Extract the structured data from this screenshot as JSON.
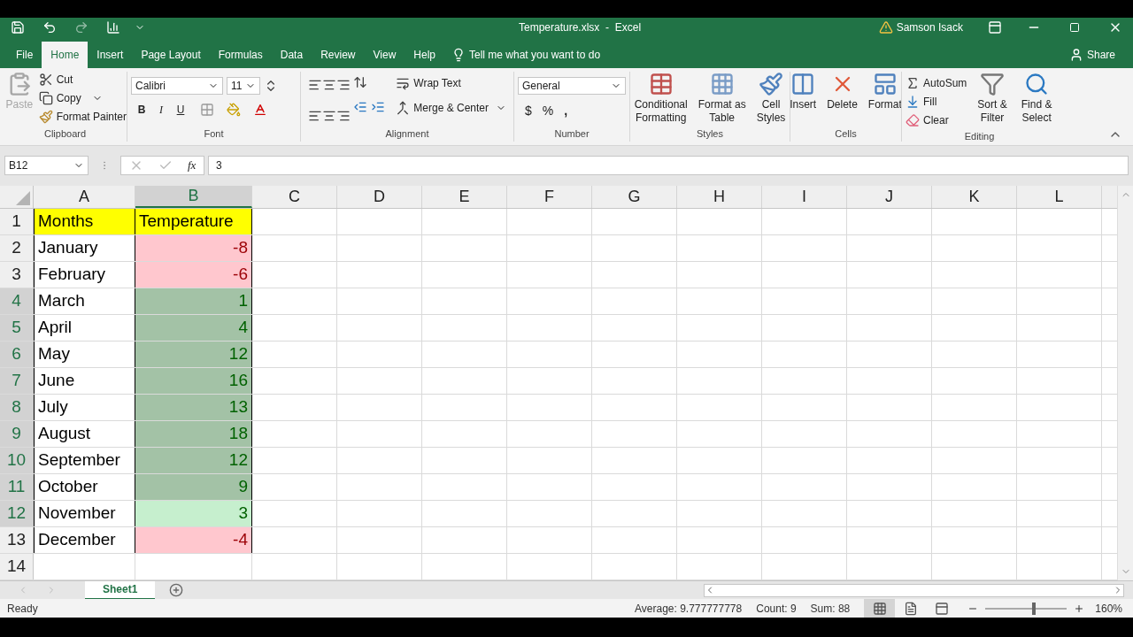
{
  "window": {
    "title": "Temperature.xlsx  -  Excel",
    "user": "Samson Isack"
  },
  "tabs": [
    {
      "label": "File",
      "selected": false
    },
    {
      "label": "Home",
      "selected": true
    },
    {
      "label": "Insert",
      "selected": false
    },
    {
      "label": "Page Layout",
      "selected": false
    },
    {
      "label": "Formulas",
      "selected": false
    },
    {
      "label": "Data",
      "selected": false
    },
    {
      "label": "Review",
      "selected": false
    },
    {
      "label": "View",
      "selected": false
    },
    {
      "label": "Help",
      "selected": false
    }
  ],
  "tell_me": {
    "placeholder": "Tell me what you want to do"
  },
  "share": "Share",
  "ribbon": {
    "clipboard": {
      "label": "Clipboard",
      "paste": {
        "label": "Paste",
        "disabled": true
      },
      "cut": "Cut",
      "copy": "Copy",
      "format_painter": "Format Painter"
    },
    "font": {
      "label": "Font",
      "font_name": "Calibri",
      "font_size": "11",
      "bold": "B",
      "italic": "I",
      "underline": "U"
    },
    "alignment": {
      "label": "Alignment",
      "wrap_text": "Wrap Text",
      "merge": "Merge & Center"
    },
    "number": {
      "label": "Number",
      "format": "General",
      "currency": "$",
      "percent": "%",
      "comma": ","
    },
    "styles": {
      "label": "Styles",
      "buttons": [
        {
          "lines": [
            "Conditional",
            "Formatting"
          ]
        },
        {
          "lines": [
            "Format as",
            "Table"
          ]
        },
        {
          "lines": [
            "Cell",
            "Styles"
          ]
        }
      ]
    },
    "cells": {
      "label": "Cells",
      "buttons": [
        {
          "label": "Insert"
        },
        {
          "label": "Delete"
        },
        {
          "label": "Format"
        }
      ]
    },
    "editing": {
      "label": "Editing",
      "autosum": "AutoSum",
      "fill": "Fill",
      "clear": "Clear",
      "buttons": [
        {
          "lines": [
            "Sort &",
            "Filter"
          ]
        },
        {
          "lines": [
            "Find &",
            "Select"
          ]
        }
      ]
    }
  },
  "formula_bar": {
    "name_box": "B12",
    "function_label": "fx",
    "value": "3"
  },
  "columns": [
    {
      "label": "A",
      "selected": false
    },
    {
      "label": "B",
      "selected": true
    },
    {
      "label": "C",
      "selected": false
    },
    {
      "label": "D",
      "selected": false
    },
    {
      "label": "E",
      "selected": false
    },
    {
      "label": "F",
      "selected": false
    },
    {
      "label": "G",
      "selected": false
    },
    {
      "label": "H",
      "selected": false
    },
    {
      "label": "I",
      "selected": false
    },
    {
      "label": "J",
      "selected": false
    },
    {
      "label": "K",
      "selected": false
    },
    {
      "label": "L",
      "selected": false
    }
  ],
  "rows": [
    {
      "number": "1",
      "selected": false,
      "kind": "header",
      "a": "Months",
      "b": "Temperature",
      "color": "#ffff00"
    },
    {
      "number": "2",
      "selected": false,
      "kind": "low",
      "a": "January",
      "b": "-8",
      "color": "#ffc7ce"
    },
    {
      "number": "3",
      "selected": false,
      "kind": "low",
      "a": "February",
      "b": "-6",
      "color": "#ffc7ce"
    },
    {
      "number": "4",
      "selected": true,
      "kind": "high",
      "a": "March",
      "b": "1",
      "color": "#a3c2a6"
    },
    {
      "number": "5",
      "selected": true,
      "kind": "high",
      "a": "April",
      "b": "4",
      "color": "#a3c2a6"
    },
    {
      "number": "6",
      "selected": true,
      "kind": "high",
      "a": "May",
      "b": "12",
      "color": "#a3c2a6"
    },
    {
      "number": "7",
      "selected": true,
      "kind": "high",
      "a": "June",
      "b": "16",
      "color": "#a3c2a6"
    },
    {
      "number": "8",
      "selected": true,
      "kind": "high",
      "a": "July",
      "b": "13",
      "color": "#a3c2a6"
    },
    {
      "number": "9",
      "selected": true,
      "kind": "high",
      "a": "August",
      "b": "18",
      "color": "#a3c2a6"
    },
    {
      "number": "10",
      "selected": true,
      "kind": "high",
      "a": "September",
      "b": "12",
      "color": "#a3c2a6"
    },
    {
      "number": "11",
      "selected": true,
      "kind": "high",
      "a": "October",
      "b": "9",
      "color": "#a3c2a6"
    },
    {
      "number": "12",
      "selected": true,
      "kind": "high",
      "a": "November",
      "b": "3",
      "color": "#c6efce"
    },
    {
      "number": "13",
      "selected": false,
      "kind": "low",
      "a": "December",
      "b": "-4",
      "color": "#ffc7ce"
    },
    {
      "number": "14",
      "selected": false,
      "kind": "empty"
    }
  ],
  "sheets": [
    {
      "label": "Sheet1",
      "selected": true
    }
  ],
  "status_bar": {
    "state": "Ready",
    "average": "Average: 9.777777778",
    "count": "Count: 9",
    "sum": "Sum: 88",
    "views": [
      {
        "kind": "normal",
        "selected": true
      },
      {
        "kind": "page_layout",
        "selected": false
      },
      {
        "kind": "page_break",
        "selected": false
      }
    ],
    "zoom": {
      "level": 0.6,
      "reading": "160%"
    }
  }
}
